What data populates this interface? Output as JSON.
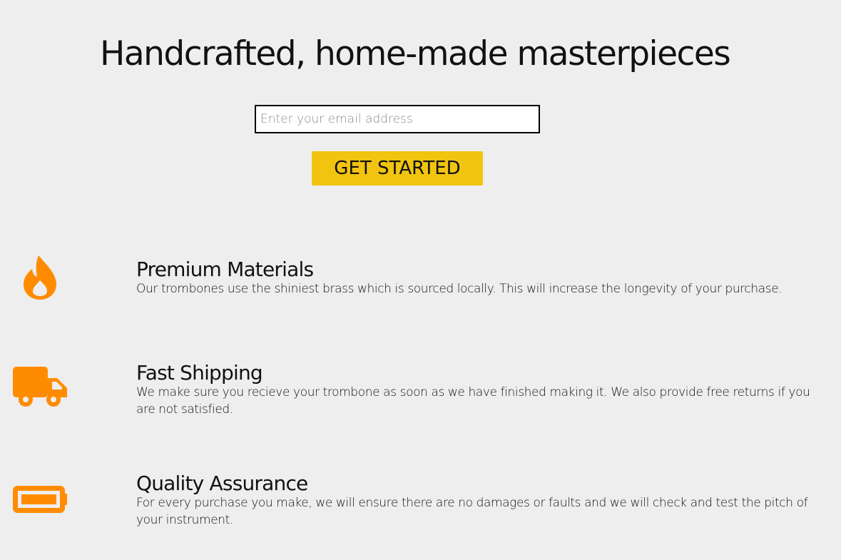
{
  "hero": {
    "title": "Handcrafted, home-made masterpieces",
    "email_placeholder": "Enter your email address",
    "button_label": "GET STARTED"
  },
  "colors": {
    "background": "#eeeeee",
    "button": "#f1c40f",
    "icon": "#ff8c00"
  },
  "features": [
    {
      "icon": "fire-icon",
      "title": "Premium Materials",
      "description": "Our trombones use the shiniest brass which is sourced locally. This will increase the longevity of your purchase."
    },
    {
      "icon": "truck-icon",
      "title": "Fast Shipping",
      "description": "We make sure you recieve your trombone as soon as we have finished making it. We also provide free returns if you are not satisfied."
    },
    {
      "icon": "battery-full-icon",
      "title": "Quality Assurance",
      "description": "For every purchase you make, we will ensure there are no damages or faults and we will check and test the pitch of your instrument."
    }
  ]
}
